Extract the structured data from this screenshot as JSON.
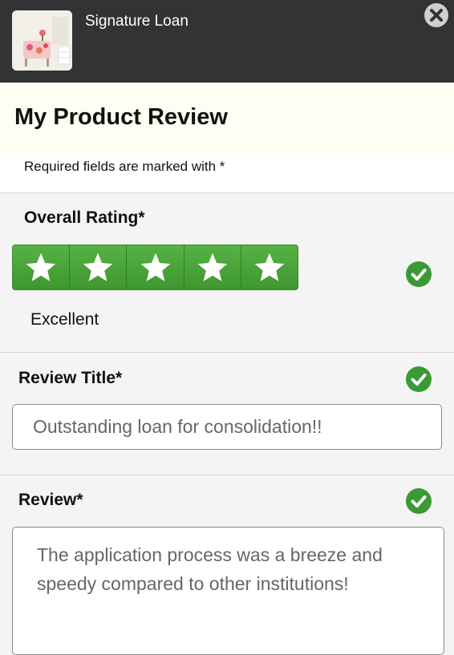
{
  "header": {
    "product_name": "Signature Loan",
    "thumbnail_icon": "armchair-photo",
    "close_icon": "close-circle-icon"
  },
  "page": {
    "title": "My Product Review",
    "required_note": "Required fields are marked with *"
  },
  "rating": {
    "label": "Overall Rating*",
    "value": 5,
    "max": 5,
    "text": "Excellent",
    "color": "#4aa33a"
  },
  "review_title": {
    "label": "Review Title*",
    "value": "Outstanding loan for consolidation!!"
  },
  "review": {
    "label": "Review*",
    "value": "The application process was a breeze and speedy compared to other institutions!"
  },
  "colors": {
    "header_bg": "#333333",
    "title_band_bg": "#fefef2",
    "valid_check": "#3a9a36"
  }
}
